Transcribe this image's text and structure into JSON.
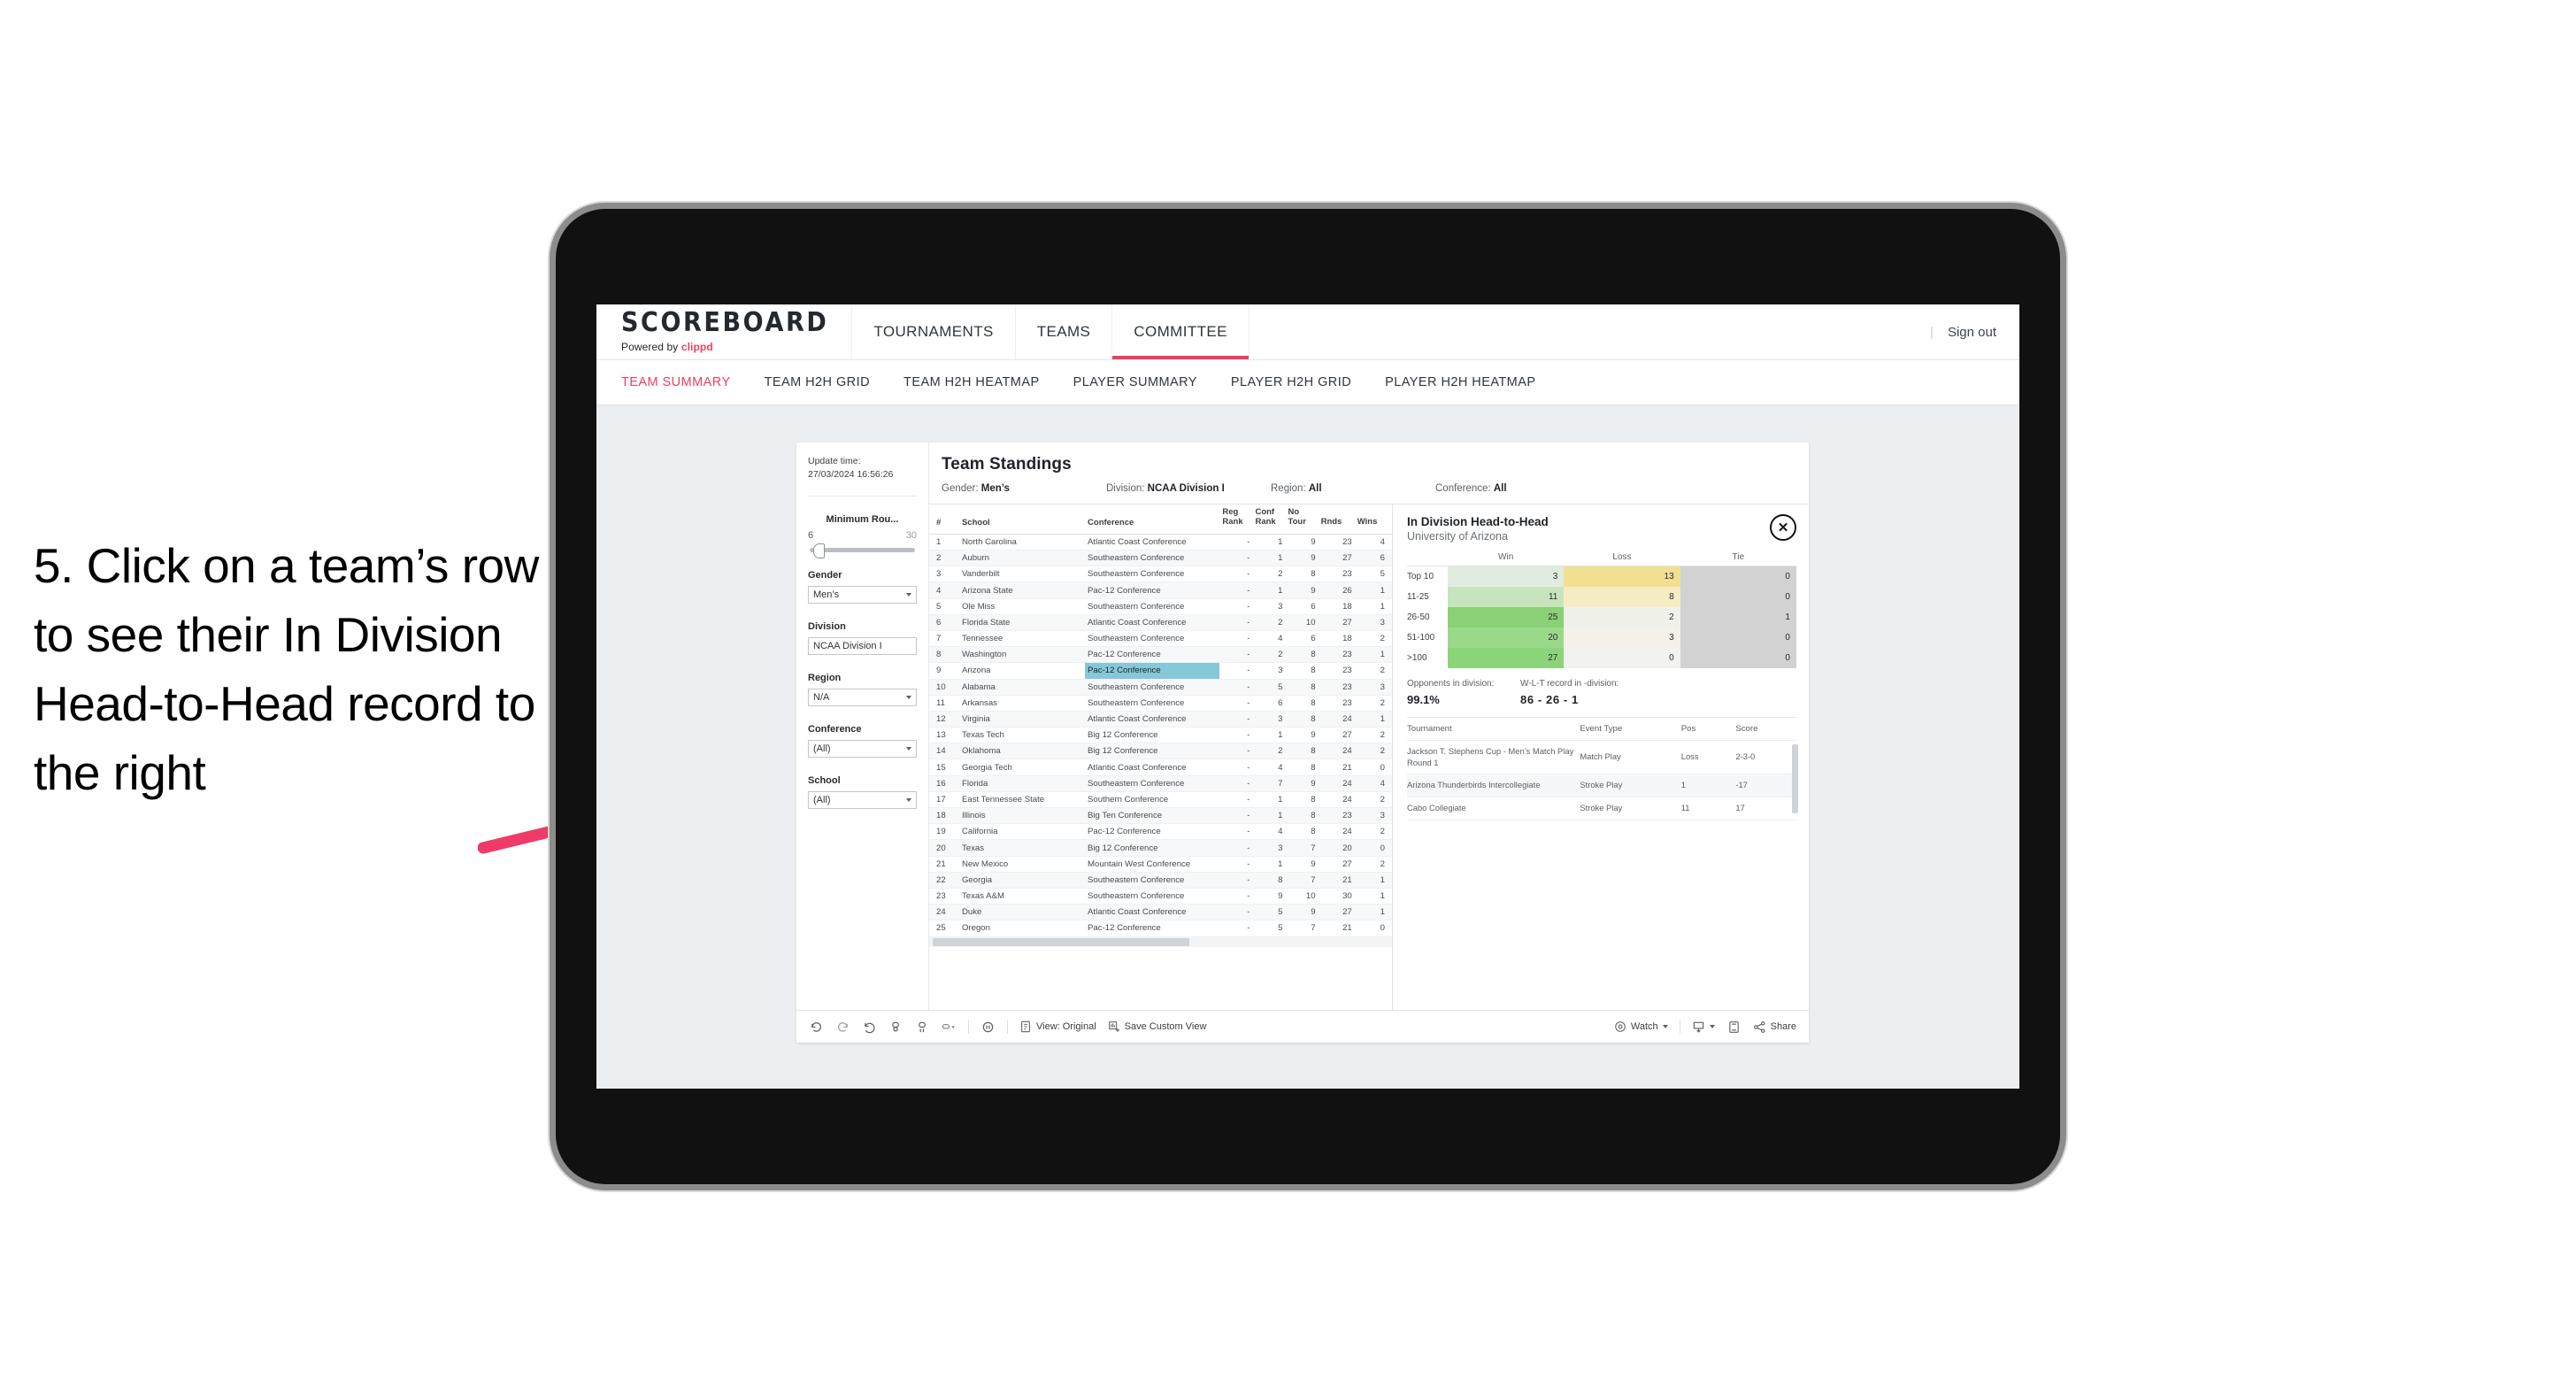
{
  "annotation": {
    "text": "5. Click on a team’s row to see their In Division Head-to-Head record to the right",
    "arrow_color": "#f03a68"
  },
  "header": {
    "brand_title": "SCOREBOARD",
    "brand_sub_prefix": "Powered by ",
    "brand_sub_name": "clippd",
    "nav": [
      {
        "label": "TOURNAMENTS",
        "active": false
      },
      {
        "label": "TEAMS",
        "active": false
      },
      {
        "label": "COMMITTEE",
        "active": true
      }
    ],
    "divider": "|",
    "sign_out": "Sign out"
  },
  "subnav": [
    {
      "label": "TEAM SUMMARY",
      "active": true
    },
    {
      "label": "TEAM H2H GRID",
      "active": false
    },
    {
      "label": "TEAM H2H HEATMAP",
      "active": false
    },
    {
      "label": "PLAYER SUMMARY",
      "active": false
    },
    {
      "label": "PLAYER H2H GRID",
      "active": false
    },
    {
      "label": "PLAYER H2H HEATMAP",
      "active": false
    }
  ],
  "filters": {
    "update_time_label": "Update time:",
    "update_time_value": "27/03/2024 16:56:26",
    "min_rounds": {
      "label": "Minimum Rou...",
      "min": "6",
      "max": "30",
      "handle_pct": 3
    },
    "selects": [
      {
        "label": "Gender",
        "value": "Men’s",
        "caret": true
      },
      {
        "label": "Division",
        "value": "NCAA Division I",
        "caret": false
      },
      {
        "label": "Region",
        "value": "N/A",
        "caret": true
      },
      {
        "label": "Conference",
        "value": "(All)",
        "caret": true
      },
      {
        "label": "School",
        "value": "(All)",
        "caret": true
      }
    ]
  },
  "main": {
    "title": "Team Standings",
    "meta": [
      {
        "label": "Gender: ",
        "value": "Men’s"
      },
      {
        "label": "Division: ",
        "value": "NCAA Division I"
      },
      {
        "label": "Region: ",
        "value": "All"
      },
      {
        "label": "Conference: ",
        "value": "All"
      }
    ],
    "columns": [
      "#",
      "School",
      "Conference",
      "Reg Rank",
      "Conf Rank",
      "No Tour",
      "Rnds",
      "Wins"
    ],
    "columns_multiline": [
      [
        "#",
        ""
      ],
      [
        "School",
        ""
      ],
      [
        "Conference",
        ""
      ],
      [
        "Reg",
        "Rank"
      ],
      [
        "Conf",
        "Rank"
      ],
      [
        "No",
        "Tour"
      ],
      [
        "",
        "Rnds"
      ],
      [
        "",
        "Wins"
      ]
    ],
    "rows": [
      {
        "n": "1",
        "school": "North Carolina",
        "conf": "Atlantic Coast Conference",
        "reg": "-",
        "cf": "1",
        "no": "9",
        "rn": "23",
        "wi": "4",
        "selected": false
      },
      {
        "n": "2",
        "school": "Auburn",
        "conf": "Southeastern Conference",
        "reg": "-",
        "cf": "1",
        "no": "9",
        "rn": "27",
        "wi": "6",
        "selected": false
      },
      {
        "n": "3",
        "school": "Vanderbilt",
        "conf": "Southeastern Conference",
        "reg": "-",
        "cf": "2",
        "no": "8",
        "rn": "23",
        "wi": "5",
        "selected": false
      },
      {
        "n": "4",
        "school": "Arizona State",
        "conf": "Pac-12 Conference",
        "reg": "-",
        "cf": "1",
        "no": "9",
        "rn": "26",
        "wi": "1",
        "selected": false
      },
      {
        "n": "5",
        "school": "Ole Miss",
        "conf": "Southeastern Conference",
        "reg": "-",
        "cf": "3",
        "no": "6",
        "rn": "18",
        "wi": "1",
        "selected": false
      },
      {
        "n": "6",
        "school": "Florida State",
        "conf": "Atlantic Coast Conference",
        "reg": "-",
        "cf": "2",
        "no": "10",
        "rn": "27",
        "wi": "3",
        "selected": false
      },
      {
        "n": "7",
        "school": "Tennessee",
        "conf": "Southeastern Conference",
        "reg": "-",
        "cf": "4",
        "no": "6",
        "rn": "18",
        "wi": "2",
        "selected": false
      },
      {
        "n": "8",
        "school": "Washington",
        "conf": "Pac-12 Conference",
        "reg": "-",
        "cf": "2",
        "no": "8",
        "rn": "23",
        "wi": "1",
        "selected": false
      },
      {
        "n": "9",
        "school": "Arizona",
        "conf": "Pac-12 Conference",
        "reg": "-",
        "cf": "3",
        "no": "8",
        "rn": "23",
        "wi": "2",
        "selected": true
      },
      {
        "n": "10",
        "school": "Alabama",
        "conf": "Southeastern Conference",
        "reg": "-",
        "cf": "5",
        "no": "8",
        "rn": "23",
        "wi": "3",
        "selected": false
      },
      {
        "n": "11",
        "school": "Arkansas",
        "conf": "Southeastern Conference",
        "reg": "-",
        "cf": "6",
        "no": "8",
        "rn": "23",
        "wi": "2",
        "selected": false
      },
      {
        "n": "12",
        "school": "Virginia",
        "conf": "Atlantic Coast Conference",
        "reg": "-",
        "cf": "3",
        "no": "8",
        "rn": "24",
        "wi": "1",
        "selected": false
      },
      {
        "n": "13",
        "school": "Texas Tech",
        "conf": "Big 12 Conference",
        "reg": "-",
        "cf": "1",
        "no": "9",
        "rn": "27",
        "wi": "2",
        "selected": false
      },
      {
        "n": "14",
        "school": "Oklahoma",
        "conf": "Big 12 Conference",
        "reg": "-",
        "cf": "2",
        "no": "8",
        "rn": "24",
        "wi": "2",
        "selected": false
      },
      {
        "n": "15",
        "school": "Georgia Tech",
        "conf": "Atlantic Coast Conference",
        "reg": "-",
        "cf": "4",
        "no": "8",
        "rn": "21",
        "wi": "0",
        "selected": false
      },
      {
        "n": "16",
        "school": "Florida",
        "conf": "Southeastern Conference",
        "reg": "-",
        "cf": "7",
        "no": "9",
        "rn": "24",
        "wi": "4",
        "selected": false
      },
      {
        "n": "17",
        "school": "East Tennessee State",
        "conf": "Southern Conference",
        "reg": "-",
        "cf": "1",
        "no": "8",
        "rn": "24",
        "wi": "2",
        "selected": false
      },
      {
        "n": "18",
        "school": "Illinois",
        "conf": "Big Ten Conference",
        "reg": "-",
        "cf": "1",
        "no": "8",
        "rn": "23",
        "wi": "3",
        "selected": false
      },
      {
        "n": "19",
        "school": "California",
        "conf": "Pac-12 Conference",
        "reg": "-",
        "cf": "4",
        "no": "8",
        "rn": "24",
        "wi": "2",
        "selected": false
      },
      {
        "n": "20",
        "school": "Texas",
        "conf": "Big 12 Conference",
        "reg": "-",
        "cf": "3",
        "no": "7",
        "rn": "20",
        "wi": "0",
        "selected": false
      },
      {
        "n": "21",
        "school": "New Mexico",
        "conf": "Mountain West Conference",
        "reg": "-",
        "cf": "1",
        "no": "9",
        "rn": "27",
        "wi": "2",
        "selected": false
      },
      {
        "n": "22",
        "school": "Georgia",
        "conf": "Southeastern Conference",
        "reg": "-",
        "cf": "8",
        "no": "7",
        "rn": "21",
        "wi": "1",
        "selected": false
      },
      {
        "n": "23",
        "school": "Texas A&M",
        "conf": "Southeastern Conference",
        "reg": "-",
        "cf": "9",
        "no": "10",
        "rn": "30",
        "wi": "1",
        "selected": false
      },
      {
        "n": "24",
        "school": "Duke",
        "conf": "Atlantic Coast Conference",
        "reg": "-",
        "cf": "5",
        "no": "9",
        "rn": "27",
        "wi": "1",
        "selected": false
      },
      {
        "n": "25",
        "school": "Oregon",
        "conf": "Pac-12 Conference",
        "reg": "-",
        "cf": "5",
        "no": "7",
        "rn": "21",
        "wi": "0",
        "selected": false
      }
    ]
  },
  "detail": {
    "title": "In Division Head-to-Head",
    "subtitle": "University of Arizona",
    "close_icon": "✕",
    "opponents_label": "Opponents in division:",
    "opponents_value": "99.1%",
    "record_label": "W-L-T record in -division:",
    "record_value": "86 - 26 - 1",
    "tour_columns": [
      "Tournament",
      "Event Type",
      "Pos",
      "Score"
    ],
    "tours": [
      {
        "name": "Jackson T. Stephens Cup - Men’s Match Play Round 1",
        "type": "Match Play",
        "pos": "Loss",
        "score": "2-3-0"
      },
      {
        "name": "Arizona Thunderbirds Intercollegiate",
        "type": "Stroke Play",
        "pos": "1",
        "score": "-17"
      },
      {
        "name": "Cabo Collegiate",
        "type": "Stroke Play",
        "pos": "11",
        "score": "17"
      }
    ]
  },
  "chart_data": {
    "type": "heatmap",
    "title": "In Division Head-to-Head",
    "subtitle": "University of Arizona",
    "columns": [
      "Win",
      "Loss",
      "Tie"
    ],
    "rows": [
      "Top 10",
      "11-25",
      "26-50",
      "51-100",
      ">100"
    ],
    "values": [
      [
        3,
        13,
        0
      ],
      [
        11,
        8,
        0
      ],
      [
        25,
        2,
        1
      ],
      [
        20,
        3,
        0
      ],
      [
        27,
        0,
        0
      ]
    ],
    "cell_colors": [
      [
        "#e1ece0",
        "#f2df91",
        "#d2d2d2"
      ],
      [
        "#c7e4bd",
        "#f6ecc4",
        "#d2d2d2"
      ],
      [
        "#8ad176",
        "#f1f1ec",
        "#d2d2d2"
      ],
      [
        "#9bd98a",
        "#f4f1e8",
        "#d2d2d2"
      ],
      [
        "#8cd47a",
        "#f2f2f0",
        "#d2d2d2"
      ]
    ],
    "legend": "none"
  },
  "toolbar": {
    "icons": [
      "undo-icon",
      "redo-icon",
      "revert-icon",
      "pause-refresh-icon",
      "refresh-icon",
      "flag-icon"
    ],
    "view_label": "View: Original",
    "save_label": "Save Custom View",
    "watch_label": "Watch",
    "share_label": "Share"
  }
}
